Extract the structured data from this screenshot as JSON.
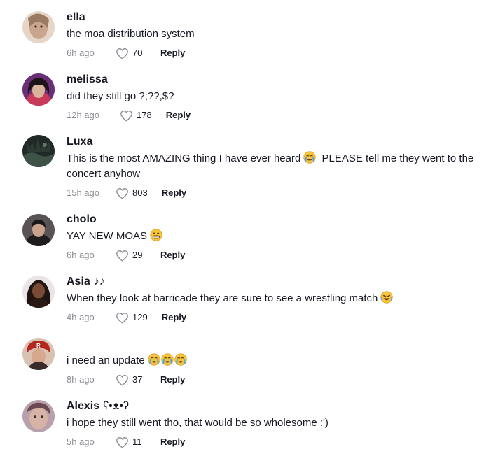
{
  "comments": [
    {
      "username": "ella",
      "deco": "",
      "text": "the moa distribution system",
      "emojis": [],
      "time": "6h ago",
      "likes": "70",
      "reply": "Reply",
      "avatar_color": "#c9a48e"
    },
    {
      "username": "melissa",
      "deco": "",
      "text": "did they still go ?;??,$?",
      "emojis": [],
      "time": "12h ago",
      "likes": "178",
      "reply": "Reply",
      "avatar_color": "#8e3a8a"
    },
    {
      "username": "Luxa",
      "deco": "",
      "text": "This is the most AMAZING thing I have ever heard",
      "emojis": [
        "crying-face"
      ],
      "text2": "PLEASE tell me they went to the concert anyhow",
      "time": "15h ago",
      "likes": "803",
      "reply": "Reply",
      "avatar_color": "#2f3b36"
    },
    {
      "username": "cholo",
      "deco": "",
      "text": "YAY NEW MOAS",
      "emojis": [
        "grin-face"
      ],
      "time": "6h ago",
      "likes": "29",
      "reply": "Reply",
      "avatar_color": "#3d3a3a"
    },
    {
      "username": "Asia",
      "deco": "♪♪",
      "text": "When they look at barricade they are sure to see a wrestling match",
      "emojis": [
        "laughing-face"
      ],
      "time": "4h ago",
      "likes": "129",
      "reply": "Reply",
      "avatar_color": "#4a2f26"
    },
    {
      "username": "",
      "deco": "",
      "text": "i need an update",
      "emojis": [
        "crying-face",
        "crying-face",
        "crying-face"
      ],
      "time": "8h ago",
      "likes": "37",
      "reply": "Reply",
      "avatar_color": "#b34a3a"
    },
    {
      "username": "Alexis",
      "deco": "ʕ•ᴥ•ʔ",
      "text": "i hope they still went tho, that would be so wholesome :')",
      "emojis": [],
      "time": "5h ago",
      "likes": "11",
      "reply": "Reply",
      "avatar_color": "#8f6a7a"
    }
  ],
  "colors": {
    "text": "#161823",
    "muted": "#8a8b91",
    "background": "#ffffff"
  }
}
